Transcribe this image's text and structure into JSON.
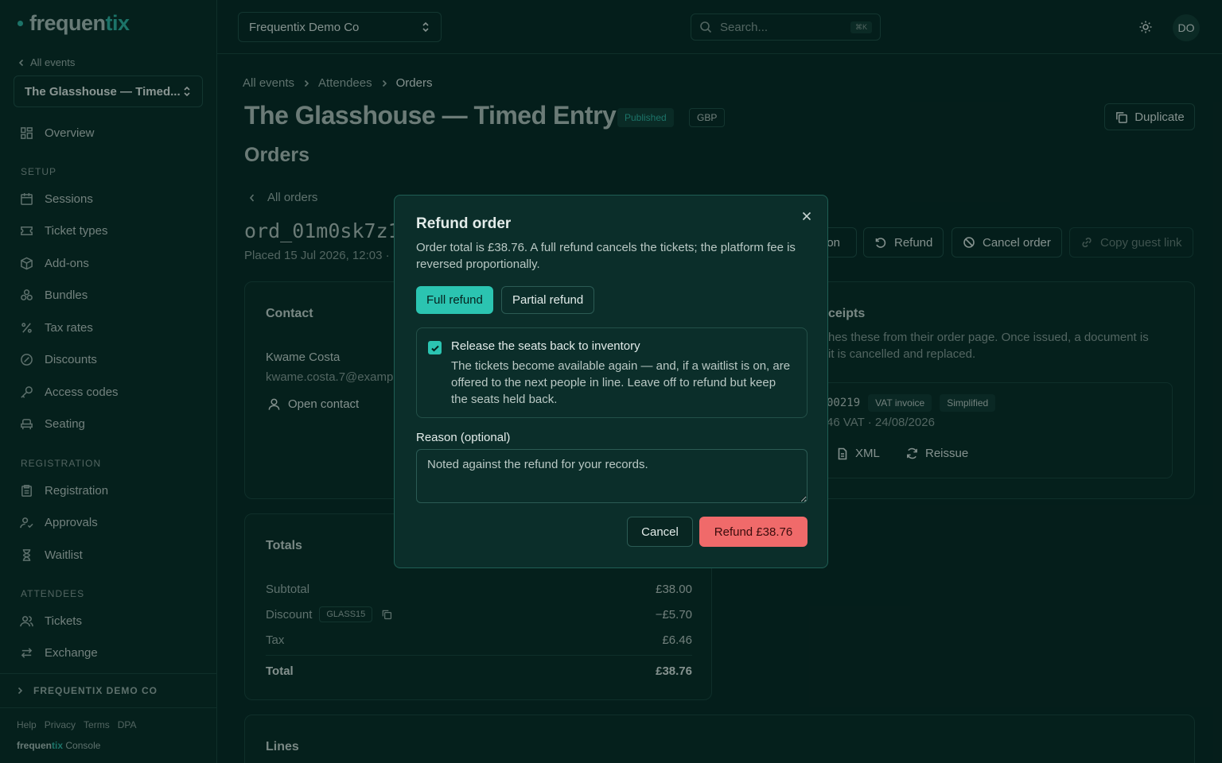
{
  "brand": {
    "name_a": "frequen",
    "name_b": "tix"
  },
  "sidebar": {
    "back_label": "All events",
    "event_name": "The Glasshouse — Timed...",
    "overview": "Overview",
    "setup_heading": "SETUP",
    "setup": [
      "Sessions",
      "Ticket types",
      "Add-ons",
      "Bundles",
      "Tax rates",
      "Discounts",
      "Access codes",
      "Seating"
    ],
    "registration_heading": "REGISTRATION",
    "registration": [
      "Registration",
      "Approvals",
      "Waitlist"
    ],
    "attendees_heading": "ATTENDEES",
    "attendees": [
      "Tickets",
      "Exchange"
    ],
    "org_label": "FREQUENTIX DEMO CO",
    "footer_links": [
      "Help",
      "Privacy",
      "Terms",
      "DPA"
    ],
    "footer_brand_suffix": "Console"
  },
  "topbar": {
    "org": "Frequentix Demo Co",
    "search_placeholder": "Search...",
    "search_kbd": "⌘K",
    "avatar": "DO"
  },
  "page": {
    "breadcrumb": [
      "All events",
      "Attendees",
      "Orders"
    ],
    "title": "The Glasshouse — Timed Entry",
    "status_badge": "Published",
    "currency_badge": "GBP",
    "duplicate_label": "Duplicate",
    "subtitle": "Orders",
    "all_orders": "All orders",
    "order_id": "ord_01m0sk7z1",
    "placed": "Placed 15 Jul 2026, 12:03 ·",
    "actions": {
      "partial": "ion",
      "refund": "Refund",
      "cancel": "Cancel order",
      "copy_link": "Copy guest link"
    }
  },
  "contact": {
    "heading": "Contact",
    "name": "Kwame Costa",
    "email": "kwame.costa.7@examp",
    "open_contact": "Open contact"
  },
  "receipts": {
    "heading": "ceipts",
    "desc_line1": "hes these from their order page. Once issued, a document is",
    "desc_line2": "it is cancelled and replaced.",
    "doc_number": "00219",
    "doc_type": "VAT invoice",
    "doc_kind": "Simplified",
    "doc_meta": "46 VAT · 24/08/2026",
    "xml_label": "XML",
    "reissue_label": "Reissue"
  },
  "totals": {
    "heading": "Totals",
    "subtotal_label": "Subtotal",
    "subtotal": "£38.00",
    "discount_label": "Discount",
    "discount_code": "GLASS15",
    "discount": "−£5.70",
    "tax_label": "Tax",
    "tax": "£6.46",
    "total_label": "Total",
    "total": "£38.76"
  },
  "lines": {
    "heading": "Lines"
  },
  "modal": {
    "title": "Refund order",
    "description": "Order total is £38.76. A full refund cancels the tickets; the platform fee is reversed proportionally.",
    "full_refund": "Full refund",
    "partial_refund": "Partial refund",
    "release_title": "Release the seats back to inventory",
    "release_desc": "The tickets become available again — and, if a waitlist is on, are offered to the next people in line. Leave off to refund but keep the seats held back.",
    "reason_label": "Reason (optional)",
    "reason_placeholder": "Noted against the refund for your records.",
    "cancel": "Cancel",
    "confirm": "Refund £38.76"
  }
}
